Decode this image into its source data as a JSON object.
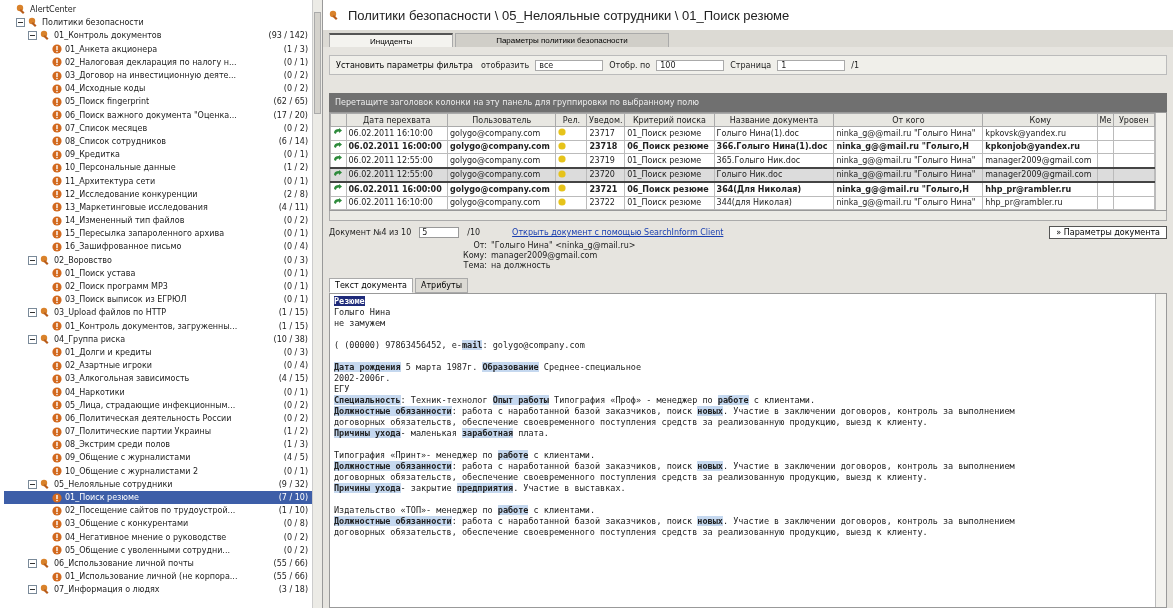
{
  "tree": {
    "label": "AlertCenter",
    "kind": "root",
    "selected": false,
    "children": [
      {
        "label": "Политики безопасности",
        "kind": "folder",
        "selected": false,
        "expanded": true,
        "children": [
          {
            "label": "01_Контроль документов",
            "count": "(93 / 142)",
            "kind": "group",
            "selected": false,
            "expanded": true,
            "children": [
              {
                "label": "01_Анкета акционера",
                "count": "(1 / 3)",
                "kind": "policy",
                "selected": false
              },
              {
                "label": "02_Налоговая декларация по налогу н...",
                "count": "(0 / 1)",
                "kind": "policy",
                "selected": false
              },
              {
                "label": "03_Договор на инвестиционную деяте...",
                "count": "(0 / 2)",
                "kind": "policy",
                "selected": false
              },
              {
                "label": "04_Исходные коды",
                "count": "(0 / 2)",
                "kind": "policy",
                "selected": false
              },
              {
                "label": "05_Поиск fingerprint",
                "count": "(62 / 65)",
                "kind": "policy",
                "selected": false
              },
              {
                "label": "06_Поиск важного документа \"Оценка...",
                "count": "(17 / 20)",
                "kind": "policy",
                "selected": false
              },
              {
                "label": "07_Список месяцев",
                "count": "(0 / 2)",
                "kind": "policy",
                "selected": false
              },
              {
                "label": "08_Список сотрудников",
                "count": "(6 / 14)",
                "kind": "policy",
                "selected": false
              },
              {
                "label": "09_Кредитка",
                "count": "(0 / 1)",
                "kind": "policy",
                "selected": false
              },
              {
                "label": "10_Персональные данные",
                "count": "(1 / 2)",
                "kind": "policy",
                "selected": false
              },
              {
                "label": "11_Архитектура сети",
                "count": "(0 / 1)",
                "kind": "policy",
                "selected": false
              },
              {
                "label": "12_Исследование конкуренции",
                "count": "(2 / 8)",
                "kind": "policy",
                "selected": false
              },
              {
                "label": "13_Маркетинговые исследования",
                "count": "(4 / 11)",
                "kind": "policy",
                "selected": false
              },
              {
                "label": "14_Измененный тип файлов",
                "count": "(0 / 2)",
                "kind": "policy",
                "selected": false
              },
              {
                "label": "15_Пересылка запароленного архива",
                "count": "(0 / 1)",
                "kind": "policy",
                "selected": false
              },
              {
                "label": "16_Зашифрованное письмо",
                "count": "(0 / 4)",
                "kind": "policy",
                "selected": false
              }
            ]
          },
          {
            "label": "02_Воровство",
            "count": "(0 / 3)",
            "kind": "group",
            "selected": false,
            "expanded": true,
            "children": [
              {
                "label": "01_Поиск устава",
                "count": "(0 / 1)",
                "kind": "policy",
                "selected": false
              },
              {
                "label": "02_Поиск программ MP3",
                "count": "(0 / 1)",
                "kind": "policy",
                "selected": false
              },
              {
                "label": "03_Поиск выписок из ЕГРЮЛ",
                "count": "(0 / 1)",
                "kind": "policy",
                "selected": false
              }
            ]
          },
          {
            "label": "03_Upload файлов по HTTP",
            "count": "(1 / 15)",
            "kind": "group",
            "selected": false,
            "expanded": true,
            "children": [
              {
                "label": "01_Контроль документов, загруженны...",
                "count": "(1 / 15)",
                "kind": "policy",
                "selected": false
              }
            ]
          },
          {
            "label": "04_Группа риска",
            "count": "(10 / 38)",
            "kind": "group",
            "selected": false,
            "expanded": true,
            "children": [
              {
                "label": "01_Долги и кредиты",
                "count": "(0 / 3)",
                "kind": "policy",
                "selected": false
              },
              {
                "label": "02_Азартные игроки",
                "count": "(0 / 4)",
                "kind": "policy",
                "selected": false
              },
              {
                "label": "03_Алкогольная зависимость",
                "count": "(4 / 15)",
                "kind": "policy",
                "selected": false
              },
              {
                "label": "04_Наркотики",
                "count": "(0 / 1)",
                "kind": "policy",
                "selected": false
              },
              {
                "label": "05_Лица, страдающие инфекционным...",
                "count": "(0 / 2)",
                "kind": "policy",
                "selected": false
              },
              {
                "label": "06_Политическая деятельность России",
                "count": "(0 / 2)",
                "kind": "policy",
                "selected": false
              },
              {
                "label": "07_Политические партии Украины",
                "count": "(1 / 2)",
                "kind": "policy",
                "selected": false
              },
              {
                "label": "08_Экстрим среди полов",
                "count": "(1 / 3)",
                "kind": "policy",
                "selected": false
              },
              {
                "label": "09_Общение с журналистами",
                "count": "(4 / 5)",
                "kind": "policy",
                "selected": false
              },
              {
                "label": "10_Общение с журналистами 2",
                "count": "(0 / 1)",
                "kind": "policy",
                "selected": false
              }
            ]
          },
          {
            "label": "05_Нелояльные сотрудники",
            "count": "(9 / 32)",
            "kind": "group",
            "selected": false,
            "expanded": true,
            "children": [
              {
                "label": "01_Поиск резюме",
                "count": "(7 / 10)",
                "kind": "policy",
                "selected": true
              },
              {
                "label": "02_Посещение сайтов по трудоустрой...",
                "count": "(1 / 10)",
                "kind": "policy",
                "selected": false
              },
              {
                "label": "03_Общение с конкурентами",
                "count": "(0 / 8)",
                "kind": "policy",
                "selected": false
              },
              {
                "label": "04_Негативное мнение о руководстве",
                "count": "(0 / 2)",
                "kind": "policy",
                "selected": false
              },
              {
                "label": "05_Общение с уволенными сотрудни...",
                "count": "(0 / 2)",
                "kind": "policy",
                "selected": false
              }
            ]
          },
          {
            "label": "06_Использование личной почты",
            "count": "(55 / 66)",
            "kind": "group",
            "selected": false,
            "expanded": true,
            "children": [
              {
                "label": "01_Использование личной (не корпора...",
                "count": "(55 / 66)",
                "kind": "policy",
                "selected": false
              }
            ]
          },
          {
            "label": "07_Информация о людях",
            "count": "(3 / 18)",
            "kind": "group",
            "selected": false,
            "expanded": true
          }
        ]
      }
    ]
  },
  "header": {
    "title": "Политики безопасности \\ 05_Нелояльные сотрудники \\ 01_Поиск резюме"
  },
  "tabs": [
    {
      "label": "Инциденты",
      "selected": true
    },
    {
      "label": "Параметры политики безопасности",
      "selected": false
    }
  ],
  "toolbar": {
    "filter": "Установить параметры фильтра",
    "show_label": "отобразить",
    "show_value": "все",
    "per_page_label": "Отобр. по",
    "per_page_value": "100",
    "page_label": "Страница",
    "page_value": "1",
    "page_total": "/1"
  },
  "group_hint": "Перетащите заголовок колонки на эту панель для группировки по выбранному полю",
  "table": {
    "columns": [
      "Дата перехвата",
      "Пользователь",
      "Рел.",
      "Уведом.",
      "Критерий поиска",
      "Название документа",
      "От кого",
      "Кому",
      "Ме",
      "Уровен"
    ],
    "rows": [
      {
        "cells": [
          "06.02.2011 16:10:00",
          "golygo@company.com",
          "",
          "23717",
          "01_Поиск резюме",
          "Голыго Нина(1).doc",
          "ninka_g@@mail.ru \"Голыго Нина\"",
          "kpkovsk@yandex.ru"
        ],
        "unread": false,
        "selected": false
      },
      {
        "cells": [
          "06.02.2011 16:00:00",
          "golygo@company.com",
          "",
          "23718",
          "06_Поиск резюме",
          "366.Голыго Нина(1).doc",
          "ninka_g@@mail.ru \"Голыго,Н",
          "kpkonjob@yandex.ru"
        ],
        "unread": true,
        "selected": false
      },
      {
        "cells": [
          "06.02.2011 12:55:00",
          "golygo@company.com",
          "",
          "23719",
          "01_Поиск резюме",
          "365.Голыго Ник.doc",
          "ninka_g@@mail.ru \"Голыго Нина\"",
          "manager2009@gmail.com"
        ],
        "unread": false,
        "selected": false
      },
      {
        "cells": [
          "06.02.2011 12:55:00",
          "golygo@company.com",
          "",
          "23720",
          "01_Поиск резюме",
          "Голыго Ник.doc",
          "ninka_g@@mail.ru \"Голыго Нина\"",
          "manager2009@gmail.com"
        ],
        "unread": false,
        "selected": true
      },
      {
        "cells": [
          "06.02.2011 16:00:00",
          "golygo@company.com",
          "",
          "23721",
          "06_Поиск резюме",
          "364(Для Николая)",
          "ninka_g@@mail.ru \"Голыго,Н",
          "hhp_pr@rambler.ru"
        ],
        "unread": true,
        "selected": false
      },
      {
        "cells": [
          "06.02.2011 16:10:00",
          "golygo@company.com",
          "",
          "23722",
          "01_Поиск резюме",
          "344(для Николая)",
          "ninka_g@@mail.ru \"Голыго Нина\"",
          "hhp_pr@rambler.ru"
        ],
        "unread": false,
        "selected": false
      }
    ]
  },
  "nav": {
    "position": "Документ №4 из 10",
    "page_value": "5",
    "page_total": "/10",
    "open_link": "Открыть документ с помощью SearchInform Client",
    "params_button": "» Параметры документа"
  },
  "meta": [
    {
      "label": "От:",
      "value": "\"Голыго Нина\" <ninka_g@mail.ru>"
    },
    {
      "label": "Кому:",
      "value": "manager2009@gmail.com"
    },
    {
      "label": "Тема:",
      "value": "на должность"
    }
  ],
  "doc_tabs": [
    {
      "label": "Текст документа",
      "selected": true
    },
    {
      "label": "Атрибуты",
      "selected": false
    }
  ],
  "document": [
    [
      [
        {
          "t": "Резюме",
          "kind": "current"
        }
      ],
      [
        {
          "t": "Голыго Нина",
          "kind": "plain"
        }
      ],
      [
        {
          "t": "не замужем",
          "kind": "plain"
        }
      ]
    ],
    [
      [
        {
          "t": "( (00000) 97863456452, e-",
          "kind": "plain"
        },
        {
          "t": "mail",
          "kind": "match"
        },
        {
          "t": ": golygo@company.com",
          "kind": "plain"
        }
      ]
    ],
    [
      [
        {
          "t": "Дата рождения",
          "kind": "match"
        },
        {
          "t": " 5 марта 1987г.  ",
          "kind": "plain"
        },
        {
          "t": "Образование",
          "kind": "match"
        },
        {
          "t": " Среднее-специальное",
          "kind": "plain"
        }
      ],
      [
        {
          "t": "2002-2006г.",
          "kind": "plain"
        }
      ],
      [
        {
          "t": "ЕГУ",
          "kind": "plain"
        }
      ],
      [
        {
          "t": "Специальность",
          "kind": "match"
        },
        {
          "t": ": Техник-технолог   ",
          "kind": "plain"
        },
        {
          "t": "Опыт работы",
          "kind": "match"
        },
        {
          "t": " Типография «Проф» - менеджер по ",
          "kind": "plain"
        },
        {
          "t": "работе",
          "kind": "match"
        },
        {
          "t": " с клиентами.",
          "kind": "plain"
        }
      ],
      [
        {
          "t": "Должностные обязанности",
          "kind": "match"
        },
        {
          "t": ": работа с наработанной базой заказчиков, поиск ",
          "kind": "plain"
        },
        {
          "t": "новых",
          "kind": "match"
        },
        {
          "t": ". Участие в заключении договоров, контроль за выполнением",
          "kind": "plain"
        }
      ],
      [
        {
          "t": "договорных обязательств, обеспечение своевременного поступления средств за реализованную продукцию, выезд к клиенту.",
          "kind": "plain"
        }
      ],
      [
        {
          "t": "Причины ухода",
          "kind": "match"
        },
        {
          "t": "- маленькая ",
          "kind": "plain"
        },
        {
          "t": "заработная",
          "kind": "match"
        },
        {
          "t": " плата.",
          "kind": "plain"
        }
      ]
    ],
    [
      [
        {
          "t": "Типография «Принт»- менеджер по ",
          "kind": "plain"
        },
        {
          "t": "работе",
          "kind": "match"
        },
        {
          "t": " с клиентами.",
          "kind": "plain"
        }
      ],
      [
        {
          "t": "Должностные обязанности",
          "kind": "match"
        },
        {
          "t": ": работа с наработанной базой заказчиков, поиск ",
          "kind": "plain"
        },
        {
          "t": "новых",
          "kind": "match"
        },
        {
          "t": ". Участие в заключении договоров, контроль за выполнением",
          "kind": "plain"
        }
      ],
      [
        {
          "t": "договорных обязательств, обеспечение своевременного поступления средств за реализованную продукцию, выезд к клиенту.",
          "kind": "plain"
        }
      ],
      [
        {
          "t": "Причины ухода",
          "kind": "match"
        },
        {
          "t": "- закрытие ",
          "kind": "plain"
        },
        {
          "t": "предприятия",
          "kind": "match"
        },
        {
          "t": ". Участие в выставках.",
          "kind": "plain"
        }
      ]
    ],
    [
      [
        {
          "t": "Издательство «ТОП»- менеджер по ",
          "kind": "plain"
        },
        {
          "t": "работе",
          "kind": "match"
        },
        {
          "t": " с клиентами.",
          "kind": "plain"
        }
      ],
      [
        {
          "t": "Должностные обязанности",
          "kind": "match"
        },
        {
          "t": ": работа с наработанной базой заказчиков, поиск ",
          "kind": "plain"
        },
        {
          "t": "новых",
          "kind": "match"
        },
        {
          "t": ". Участие в заключении договоров, контроль за выполнением",
          "kind": "plain"
        }
      ],
      [
        {
          "t": "договорных обязательств, обеспечение своевременного поступления средств за реализованную продукцию, выезд к клиенту.",
          "kind": "plain"
        }
      ]
    ]
  ]
}
